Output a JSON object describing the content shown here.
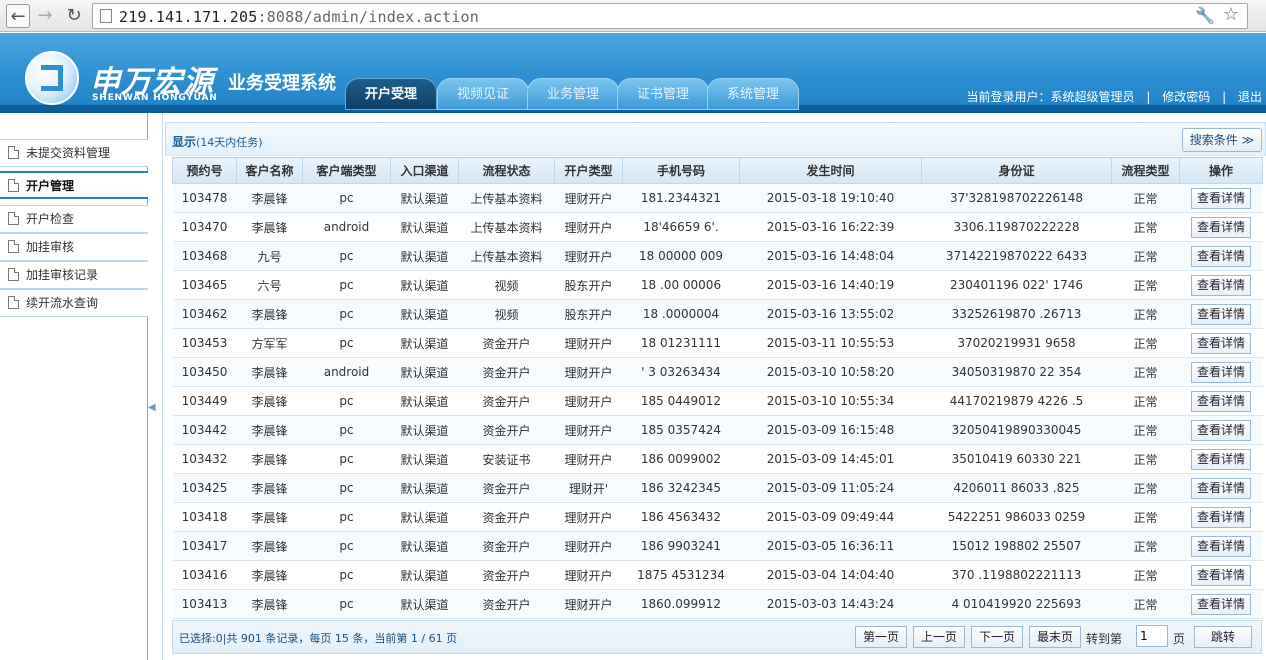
{
  "browser": {
    "url_host": "219.141.171.205",
    "url_rest": ":8088/admin/index.action"
  },
  "header": {
    "brand_cn": "申万宏源",
    "brand_en": "SHENWAN HONGYUAN",
    "system_name": "业务受理系统",
    "tabs": [
      {
        "label": "开户受理",
        "active": true
      },
      {
        "label": "视频见证",
        "active": false
      },
      {
        "label": "业务管理",
        "active": false
      },
      {
        "label": "证书管理",
        "active": false
      },
      {
        "label": "系统管理",
        "active": false
      }
    ],
    "current_user": "当前登录用户：系统超级管理员",
    "sep": "|",
    "change_password": "修改密码",
    "logout": "退出"
  },
  "sidebar": {
    "items": [
      {
        "label": "未提交资料管理",
        "active": false
      },
      {
        "label": "开户管理",
        "active": true
      },
      {
        "label": "开户检查",
        "active": false
      },
      {
        "label": "加挂审核",
        "active": false
      },
      {
        "label": "加挂审核记录",
        "active": false
      },
      {
        "label": "续开流水查询",
        "active": false
      }
    ]
  },
  "panel": {
    "title": "显示",
    "subtitle": "(14天内任务)",
    "search_label": "搜索条件 ≫"
  },
  "table": {
    "columns": [
      "预约号",
      "客户名称",
      "客户端类型",
      "入口渠道",
      "流程状态",
      "开户类型",
      "手机号码",
      "发生时间",
      "身份证",
      "流程类型",
      "操作"
    ],
    "action_label": "查看详情",
    "rows": [
      [
        "103478",
        "李晨锋",
        "pc",
        "默认渠道",
        "上传基本资料",
        "理财开户",
        "181.2344321",
        "2015-03-18 19:10:40",
        "37'328198702226148",
        "正常"
      ],
      [
        "103470",
        "李晨锋",
        "android",
        "默认渠道",
        "上传基本资料",
        "理财开户",
        "18'46659 6'.",
        "2015-03-16 16:22:39",
        "3306.119870222228",
        "正常"
      ],
      [
        "103468",
        "九号",
        "pc",
        "默认渠道",
        "上传基本资料",
        "理财开户",
        "18 00000 009",
        "2015-03-16 14:48:04",
        "37142219870222 6433",
        "正常"
      ],
      [
        "103465",
        "六号",
        "pc",
        "默认渠道",
        "视频",
        "股东开户",
        "18 .00  00006",
        "2015-03-16 14:40:19",
        "230401196 022' 1746",
        "正常"
      ],
      [
        "103462",
        "李晨锋",
        "pc",
        "默认渠道",
        "视频",
        "股东开户",
        "18 .0000004",
        "2015-03-16 13:55:02",
        "33252619870 .26713",
        "正常"
      ],
      [
        "103453",
        "方军军",
        "pc",
        "默认渠道",
        "资金开户",
        "理财开户",
        "18 01231111",
        "2015-03-11 10:55:53",
        "37020219931 9658",
        "正常"
      ],
      [
        "103450",
        "李晨锋",
        "android",
        "默认渠道",
        "资金开户",
        "理财开户",
        "' 3 03263434",
        "2015-03-10 10:58:20",
        "34050319870 22 354",
        "正常"
      ],
      [
        "103449",
        "李晨锋",
        "pc",
        "默认渠道",
        "资金开户",
        "理财开户",
        "185 0449012",
        "2015-03-10 10:55:34",
        "44170219879 4226 .5",
        "正常"
      ],
      [
        "103442",
        "李晨锋",
        "pc",
        "默认渠道",
        "资金开户",
        "理财开户",
        "185 0357424",
        "2015-03-09 16:15:48",
        "32050419890330045",
        "正常"
      ],
      [
        "103432",
        "李晨锋",
        "pc",
        "默认渠道",
        "安装证书",
        "理财开户",
        "186 0099002",
        "2015-03-09 14:45:01",
        "35010419 60330 221",
        "正常"
      ],
      [
        "103425",
        "李晨锋",
        "pc",
        "默认渠道",
        "资金开户",
        "理财开'",
        "186 3242345",
        "2015-03-09 11:05:24",
        "4206011 86033 .825",
        "正常"
      ],
      [
        "103418",
        "李晨锋",
        "pc",
        "默认渠道",
        "资金开户",
        "理财开户",
        "186 4563432",
        "2015-03-09 09:49:44",
        "5422251 986033 0259",
        "正常"
      ],
      [
        "103417",
        "李晨锋",
        "pc",
        "默认渠道",
        "资金开户",
        "理财开户",
        "186 9903241",
        "2015-03-05 16:36:11",
        "15012 198802 25507",
        "正常"
      ],
      [
        "103416",
        "李晨锋",
        "pc",
        "默认渠道",
        "资金开户",
        "理财开户",
        "1875 4531234",
        "2015-03-04 14:04:40",
        "370 .1198802221113",
        "正常"
      ],
      [
        "103413",
        "李晨锋",
        "pc",
        "默认渠道",
        "资金开户",
        "理财开户",
        "1860.099912",
        "2015-03-03 14:43:24",
        "4 010419920 225693",
        "正常"
      ]
    ]
  },
  "pager": {
    "info": "已选择:0|共 901 条记录，每页 15 条，当前第 1 / 61 页",
    "first": "第一页",
    "prev": "上一页",
    "next": "下一页",
    "last": "最末页",
    "goto_label": "转到第",
    "page_value": "1",
    "page_unit": "页",
    "go": "跳转"
  }
}
